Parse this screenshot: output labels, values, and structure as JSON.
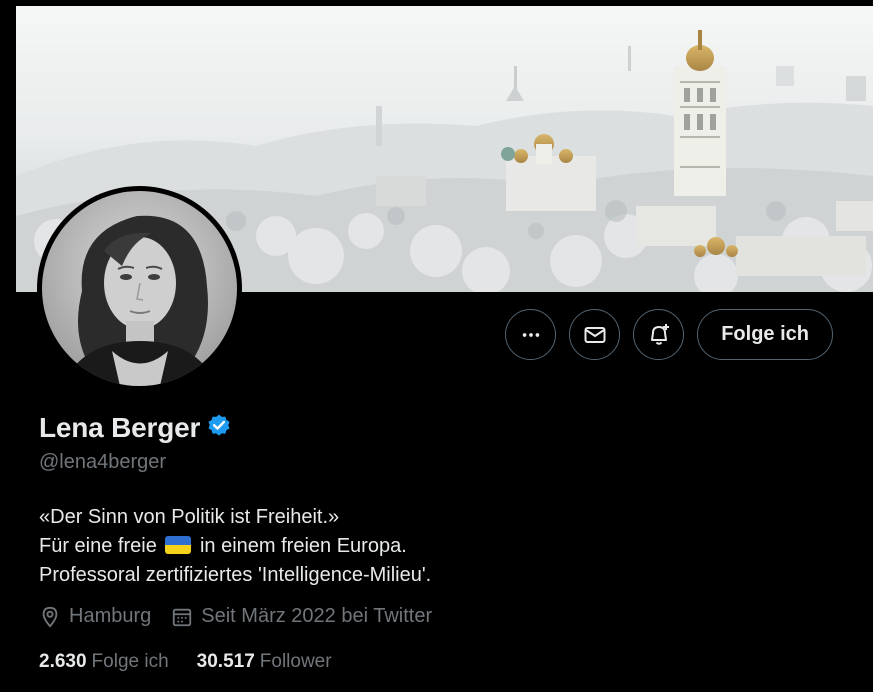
{
  "profile": {
    "display_name": "Lena Berger",
    "handle": "@lena4berger",
    "verified": true,
    "bio_line1": "«Der Sinn von Politik ist Freiheit.»",
    "bio_line2_before": "Für eine freie",
    "bio_line2_flag": "ukraine-flag",
    "bio_line2_after": "in einem freien Europa.",
    "bio_line3": "Professoral zertifiziertes 'Intelligence-Milieu'.",
    "location": "Hamburg",
    "joined": "Seit März 2022 bei Twitter"
  },
  "actions": {
    "more_icon": "more-dots-icon",
    "message_icon": "envelope-icon",
    "notify_icon": "bell-plus-icon",
    "follow_label": "Folge ich"
  },
  "stats": {
    "following_count": "2.630",
    "following_label": "Folge ich",
    "followers_count": "30.517",
    "followers_label": "Follower"
  },
  "colors": {
    "background": "#000000",
    "text_primary": "#e7e9ea",
    "text_secondary": "#71767b",
    "border": "#536471",
    "verified_blue": "#1d9bf0"
  }
}
